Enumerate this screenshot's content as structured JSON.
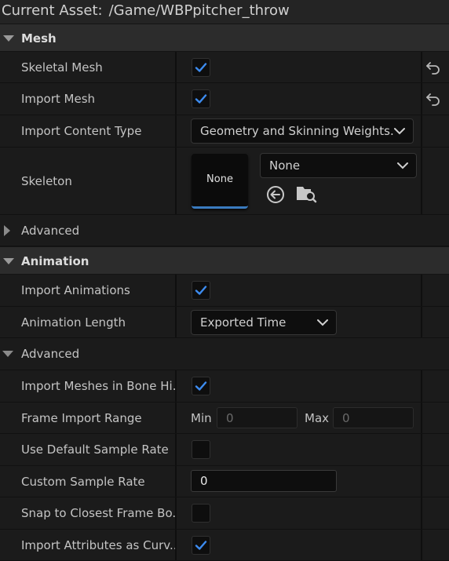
{
  "header": {
    "label": "Current Asset:",
    "path": "/Game/WBPpitcher_throw"
  },
  "mesh": {
    "title": "Mesh",
    "skeletal_mesh": "Skeletal Mesh",
    "import_mesh": "Import Mesh",
    "import_content_type": "Import Content Type",
    "import_content_type_value": "Geometry and Skinning Weights.",
    "skeleton": "Skeleton",
    "skeleton_thumb": "None",
    "skeleton_value": "None",
    "advanced": "Advanced"
  },
  "animation": {
    "title": "Animation",
    "import_animations": "Import Animations",
    "animation_length": "Animation Length",
    "animation_length_value": "Exported Time",
    "advanced": "Advanced",
    "import_meshes_bone": "Import Meshes in Bone Hi...",
    "frame_import_range": "Frame Import Range",
    "min_label": "Min",
    "min_placeholder": "0",
    "max_label": "Max",
    "max_placeholder": "0",
    "use_default_sample_rate": "Use Default Sample Rate",
    "custom_sample_rate": "Custom Sample Rate",
    "custom_sample_rate_value": "0",
    "snap_closest_frame": "Snap to Closest Frame Bo...",
    "import_attributes_curves": "Import Attributes as Curv..."
  },
  "colors": {
    "accent": "#3a7bbf",
    "check": "#3d8cf0"
  }
}
